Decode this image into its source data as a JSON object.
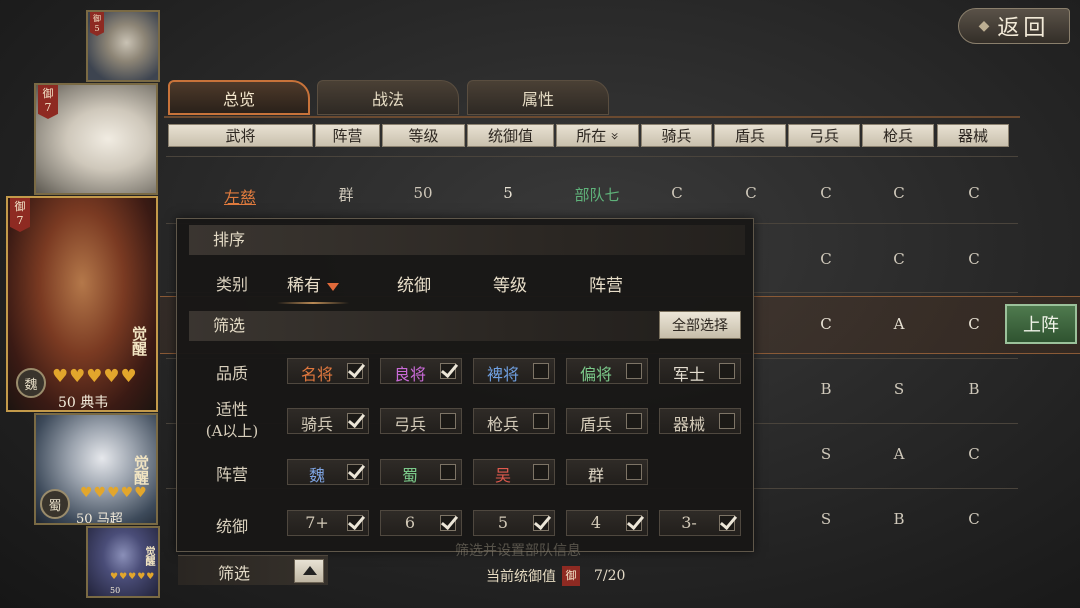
{
  "back_button": {
    "label": "返回"
  },
  "cards": [
    {
      "tag_label": "御",
      "tag_value": "5",
      "hearts": "",
      "level": "",
      "name": "",
      "faction": "",
      "awaken": ""
    },
    {
      "tag_label": "御",
      "tag_value": "7",
      "hearts": "",
      "level": "",
      "name": "",
      "faction": "",
      "awaken": ""
    },
    {
      "tag_label": "御",
      "tag_value": "7",
      "hearts": "♥♥♥♥♥",
      "level": "50",
      "name": "典韦",
      "faction": "魏",
      "awaken": "觉醒"
    },
    {
      "tag_label": "",
      "tag_value": "",
      "hearts": "♥♥♥♥♥",
      "level": "50",
      "name": "马超",
      "faction": "蜀",
      "awaken": "觉醒"
    },
    {
      "tag_label": "",
      "tag_value": "",
      "hearts": "♥♥♥♥♥",
      "level": "50",
      "name": "",
      "faction": "",
      "awaken": "觉醒"
    }
  ],
  "tabs": [
    {
      "label": "总览"
    },
    {
      "label": "战法"
    },
    {
      "label": "属性"
    }
  ],
  "table": {
    "headers": [
      "武将",
      "阵营",
      "等级",
      "统御值",
      "所在",
      "骑兵",
      "盾兵",
      "弓兵",
      "枪兵",
      "器械"
    ],
    "location_sort_glyph": "»",
    "first_row": {
      "name": "左慈",
      "faction": "群",
      "level": "50",
      "leadership": "5",
      "location": "部队七",
      "cav": "C",
      "shield": "C",
      "bow": "C",
      "spear": "C",
      "siege": "C"
    },
    "visible_tail_cells": [
      {
        "row": 2,
        "bow": "C",
        "spear": "C",
        "siege": "C"
      },
      {
        "row": 3,
        "bow": "C",
        "spear": "A",
        "siege": "C"
      },
      {
        "row": 4,
        "bow": "B",
        "spear": "S",
        "siege": "B"
      },
      {
        "row": 5,
        "bow": "S",
        "spear": "A",
        "siege": "C"
      },
      {
        "row": 6,
        "bow": "S",
        "spear": "B",
        "siege": "C"
      }
    ],
    "deploy_button": "上阵"
  },
  "filter_popup": {
    "sort_title": "排序",
    "category_label": "类别",
    "sort_options": [
      "稀有",
      "统御",
      "等级",
      "阵营"
    ],
    "filter_title": "筛选",
    "select_all": "全部选择",
    "quality": {
      "label": "品质",
      "options": [
        {
          "text": "名将",
          "checked": true,
          "color": "#e0783e"
        },
        {
          "text": "良将",
          "checked": true,
          "color": "#c86ad6"
        },
        {
          "text": "裨将",
          "checked": false,
          "color": "#6f9fe0"
        },
        {
          "text": "偏将",
          "checked": false,
          "color": "#7bc98a"
        },
        {
          "text": "军士",
          "checked": false,
          "color": "#e4ddd0"
        }
      ]
    },
    "aptitude": {
      "label": "适性",
      "sub_label": "(A以上)",
      "options": [
        {
          "text": "骑兵",
          "checked": true
        },
        {
          "text": "弓兵",
          "checked": false
        },
        {
          "text": "枪兵",
          "checked": false
        },
        {
          "text": "盾兵",
          "checked": false
        },
        {
          "text": "器械",
          "checked": false
        }
      ]
    },
    "camp": {
      "label": "阵营",
      "options": [
        {
          "text": "魏",
          "checked": true,
          "color": "#7ea4e2"
        },
        {
          "text": "蜀",
          "checked": false,
          "color": "#7bc98a"
        },
        {
          "text": "吴",
          "checked": false,
          "color": "#e05a4e"
        },
        {
          "text": "群",
          "checked": false,
          "color": "#dcd4c2"
        }
      ]
    },
    "leadership": {
      "label": "统御",
      "options": [
        {
          "text": "7+",
          "checked": true
        },
        {
          "text": "6",
          "checked": true
        },
        {
          "text": "5",
          "checked": true
        },
        {
          "text": "4",
          "checked": true
        },
        {
          "text": "3-",
          "checked": true
        }
      ]
    }
  },
  "bottom": {
    "filter_label": "筛选",
    "hint": "筛选并设置部队信息",
    "leadership_label": "当前统御值",
    "leadership_badge": "御",
    "leadership_value": "7/20"
  }
}
